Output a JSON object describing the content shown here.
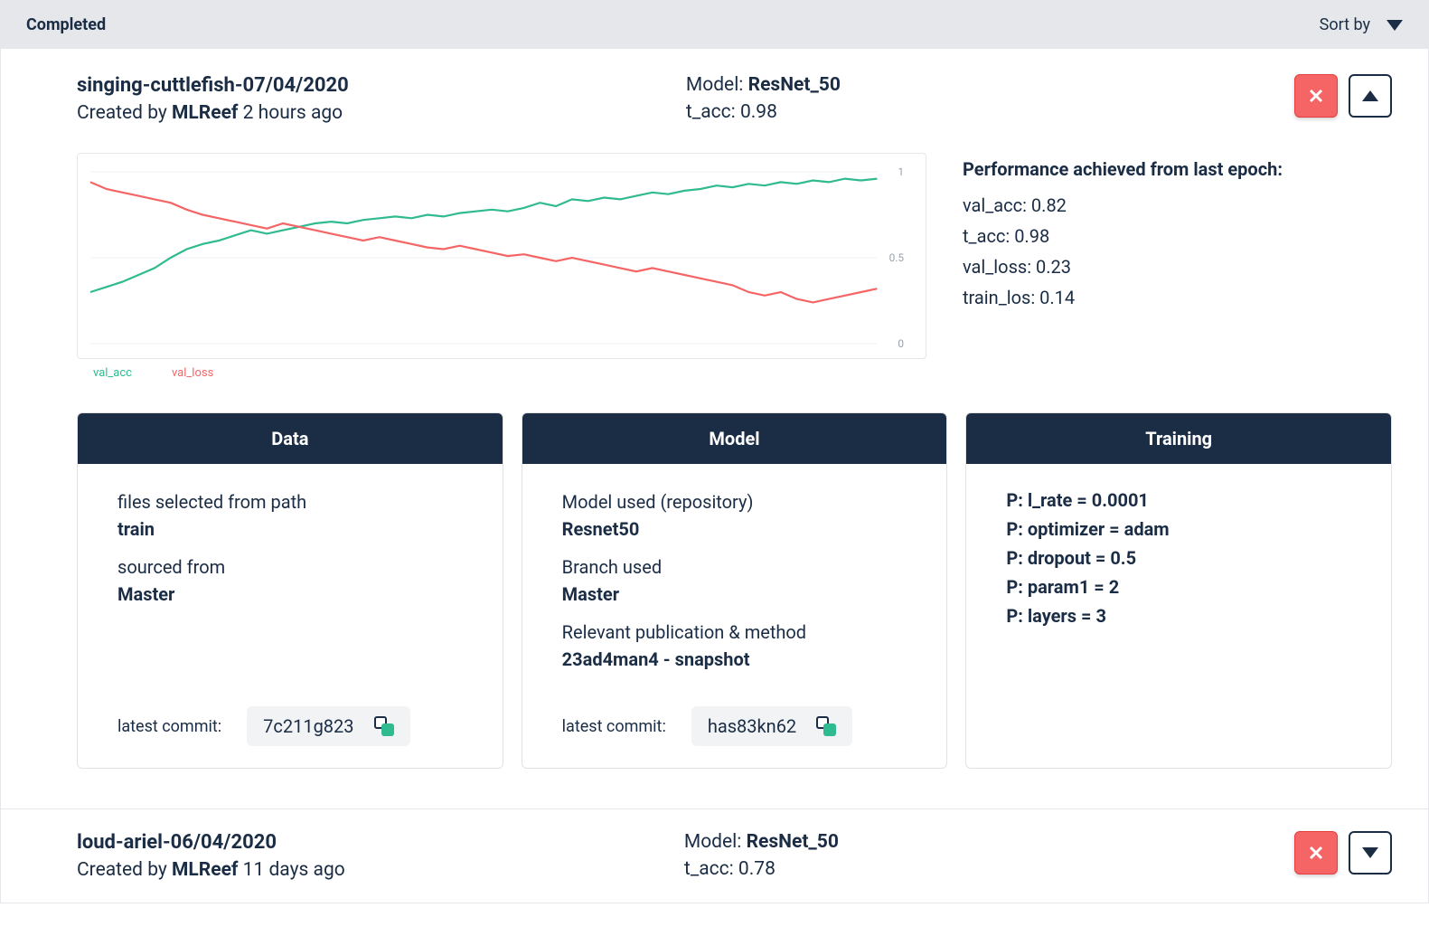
{
  "section": {
    "title": "Completed",
    "sort_label": "Sort by"
  },
  "runs": [
    {
      "name": "singing-cuttlefish-07/04/2020",
      "created_prefix": "Created by ",
      "owner": "MLReef",
      "created_suffix": " 2 hours ago",
      "model_label": "Model: ",
      "model_value": "ResNet_50",
      "metric_line": "t_acc: 0.98",
      "performance": {
        "title": "Performance achieved from last epoch:",
        "items": [
          "val_acc: 0.82",
          "t_acc: 0.98",
          "val_loss: 0.23",
          "train_los: 0.14"
        ]
      },
      "columns": {
        "data": {
          "header": "Data",
          "files_label": "files selected from path",
          "files_value": "train",
          "sourced_label": "sourced from",
          "sourced_value": "Master",
          "commit_label": "latest commit:",
          "commit_hash": "7c211g823"
        },
        "model": {
          "header": "Model",
          "used_label": "Model used (repository)",
          "used_value": "Resnet50",
          "branch_label": "Branch used",
          "branch_value": "Master",
          "pub_label": "Relevant publication & method",
          "pub_value": "23ad4man4 - snapshot",
          "commit_label": "latest commit:",
          "commit_hash": "has83kn62"
        },
        "training": {
          "header": "Training",
          "params": [
            "P: l_rate = 0.0001",
            "P: optimizer = adam",
            "P: dropout = 0.5",
            "P: param1 = 2",
            "P: layers = 3"
          ]
        }
      },
      "legend": {
        "acc": "val_acc",
        "loss": "val_loss"
      }
    },
    {
      "name": "loud-ariel-06/04/2020",
      "created_prefix": "Created by ",
      "owner": "MLReef",
      "created_suffix": " 11 days ago",
      "model_label": "Model: ",
      "model_value": "ResNet_50",
      "metric_line": "t_acc: 0.78"
    }
  ],
  "chart_data": {
    "type": "line",
    "x": [
      0,
      1,
      2,
      3,
      4,
      5,
      6,
      7,
      8,
      9,
      10,
      11,
      12,
      13,
      14,
      15,
      16,
      17,
      18,
      19,
      20,
      21,
      22,
      23,
      24,
      25,
      26,
      27,
      28,
      29,
      30,
      31,
      32,
      33,
      34,
      35,
      36,
      37,
      38,
      39,
      40,
      41,
      42,
      43,
      44,
      45,
      46,
      47,
      48,
      49
    ],
    "series": [
      {
        "name": "val_acc",
        "color": "#30ba8f",
        "values": [
          0.3,
          0.33,
          0.36,
          0.4,
          0.44,
          0.5,
          0.55,
          0.58,
          0.6,
          0.63,
          0.66,
          0.64,
          0.66,
          0.68,
          0.7,
          0.71,
          0.7,
          0.72,
          0.73,
          0.74,
          0.73,
          0.75,
          0.74,
          0.76,
          0.77,
          0.78,
          0.77,
          0.79,
          0.82,
          0.8,
          0.84,
          0.83,
          0.85,
          0.84,
          0.86,
          0.88,
          0.87,
          0.89,
          0.9,
          0.92,
          0.91,
          0.93,
          0.92,
          0.94,
          0.93,
          0.95,
          0.94,
          0.96,
          0.95,
          0.96
        ]
      },
      {
        "name": "val_loss",
        "color": "#f56565",
        "values": [
          0.94,
          0.9,
          0.88,
          0.86,
          0.84,
          0.82,
          0.78,
          0.75,
          0.73,
          0.71,
          0.69,
          0.67,
          0.7,
          0.68,
          0.66,
          0.64,
          0.62,
          0.6,
          0.62,
          0.6,
          0.58,
          0.56,
          0.55,
          0.57,
          0.55,
          0.53,
          0.51,
          0.52,
          0.5,
          0.48,
          0.5,
          0.48,
          0.46,
          0.44,
          0.42,
          0.44,
          0.42,
          0.4,
          0.38,
          0.36,
          0.34,
          0.3,
          0.28,
          0.3,
          0.26,
          0.24,
          0.26,
          0.28,
          0.3,
          0.32
        ]
      }
    ],
    "ylim": [
      0,
      1
    ],
    "yticks": [
      0,
      0.5,
      1
    ]
  }
}
